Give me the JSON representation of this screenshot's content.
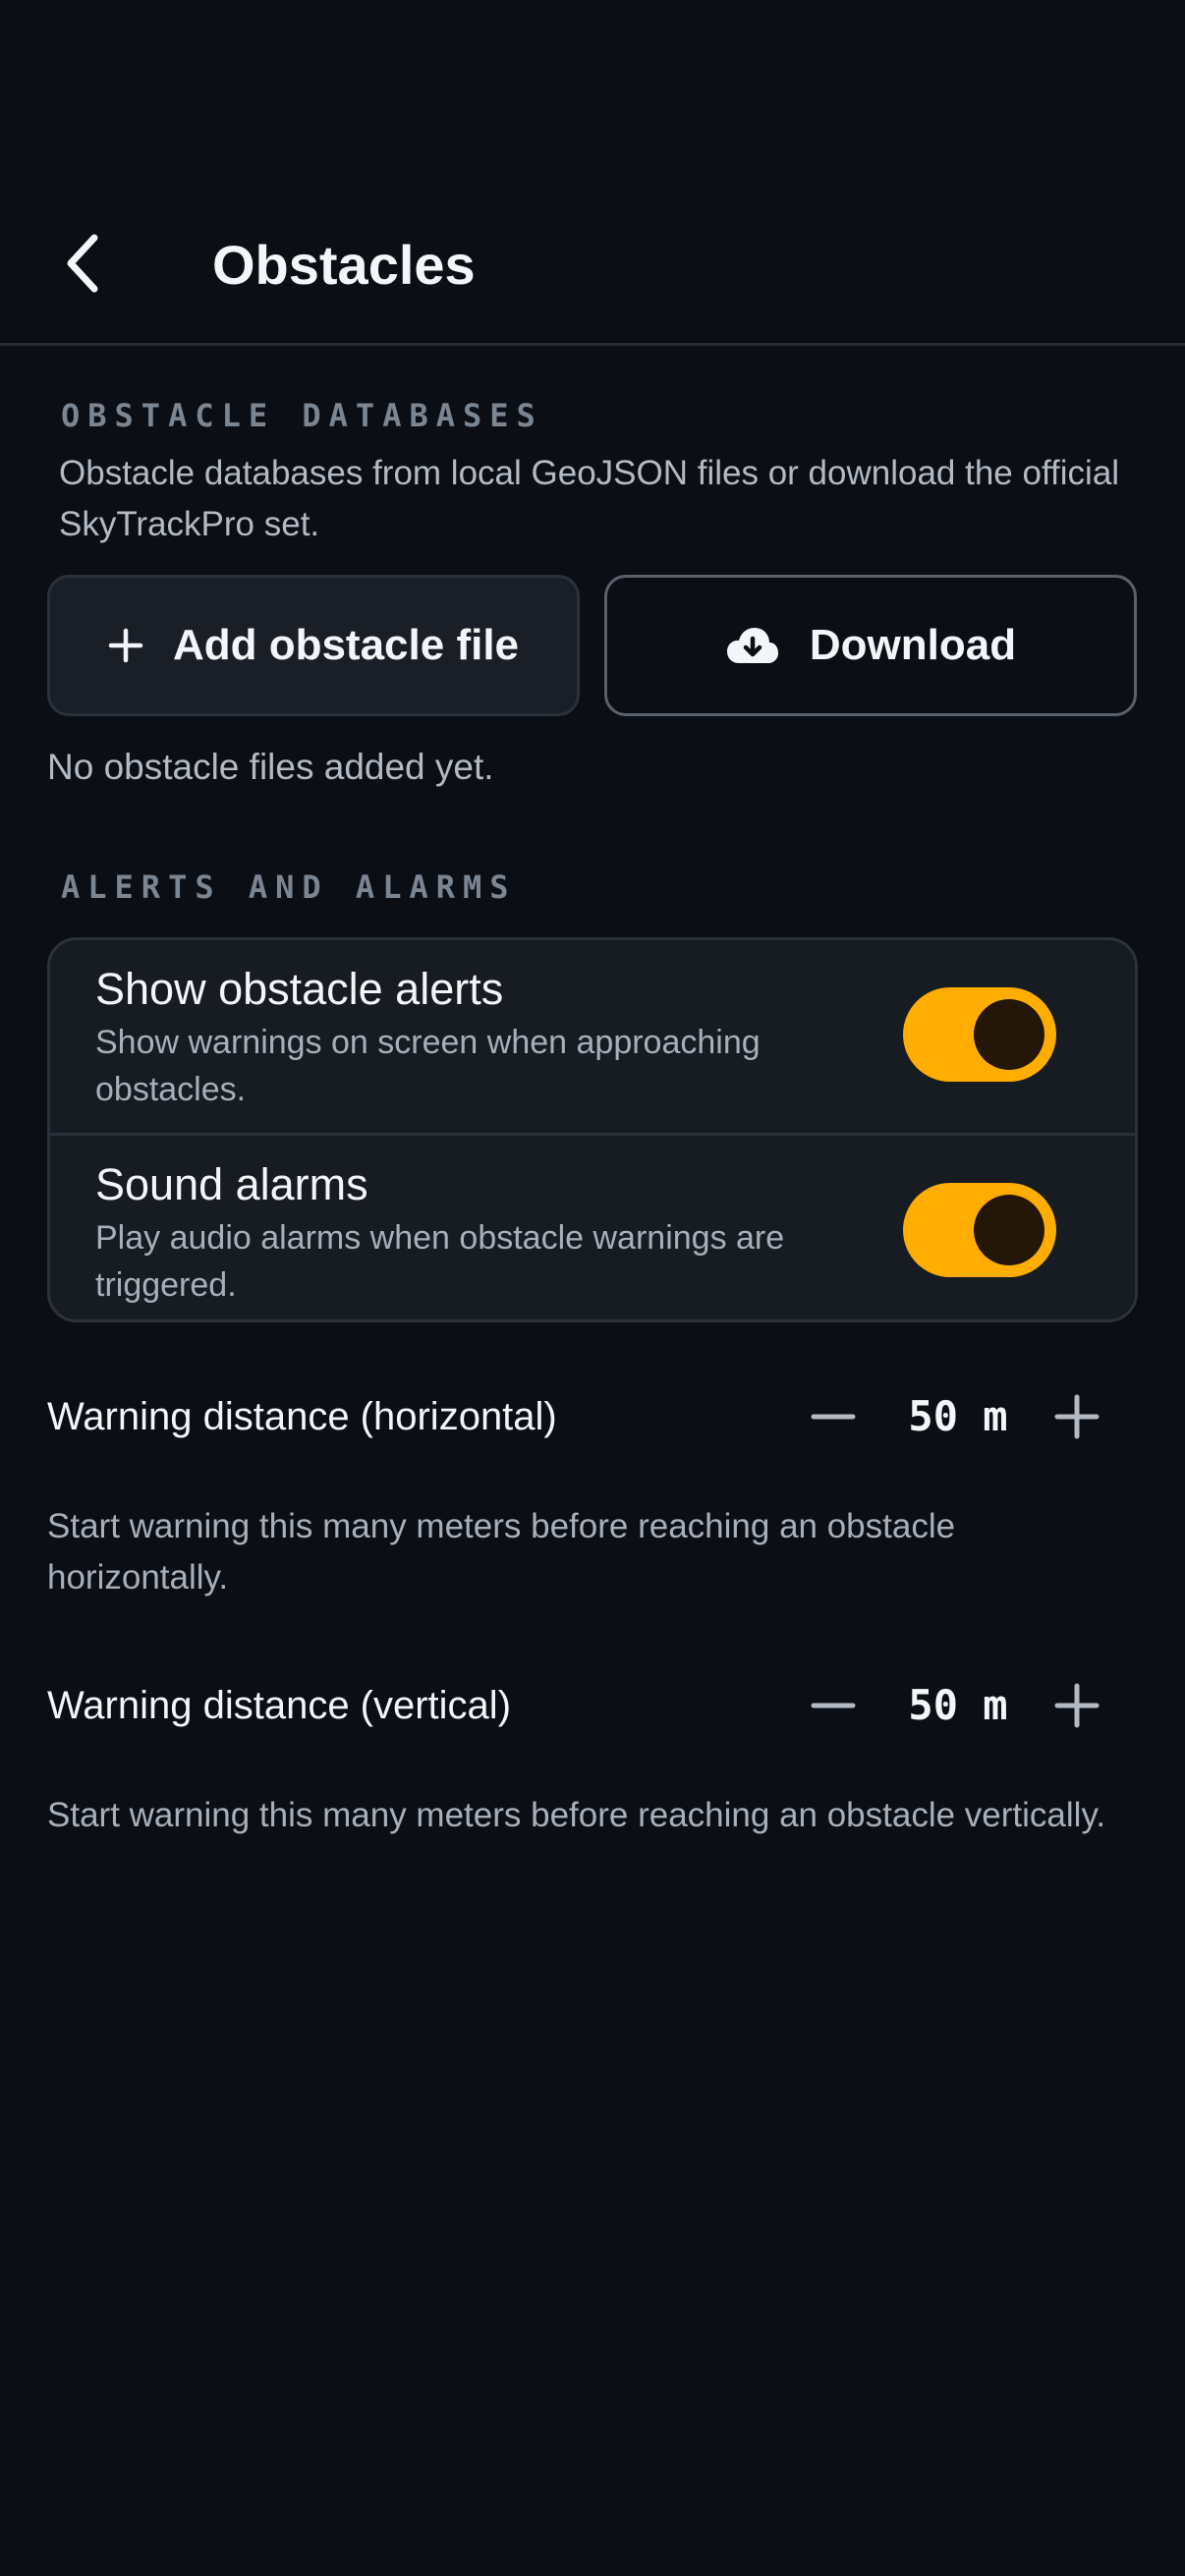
{
  "header": {
    "title": "Obstacles",
    "back_icon": "chevron-left-icon"
  },
  "obstacle_databases": {
    "section_label": "OBSTACLE DATABASES",
    "description": "Obstacle databases from local GeoJSON files or download the official SkyTrackPro set.",
    "add_button": {
      "label": "Add obstacle file",
      "icon": "plus-icon"
    },
    "download_button": {
      "label": "Download",
      "icon": "cloud-download-icon"
    },
    "empty_text": "No obstacle files added yet."
  },
  "alerts": {
    "section_label": "ALERTS AND ALARMS",
    "rows": [
      {
        "title": "Show obstacle alerts",
        "description": "Show warnings on screen when approaching obstacles.",
        "enabled": true
      },
      {
        "title": "Sound alarms",
        "description": "Play audio alarms when obstacle warnings are triggered.",
        "enabled": true
      }
    ]
  },
  "warning_horizontal": {
    "label": "Warning distance (horizontal)",
    "value": "50 m",
    "description": "Start warning this many meters before reaching an obstacle horizontally."
  },
  "warning_vertical": {
    "label": "Warning distance (vertical)",
    "value": "50 m",
    "description": "Start warning this many meters before reaching an obstacle vertically."
  },
  "colors": {
    "background": "#0b0e15",
    "accent": "#ffad00",
    "card": "#171c23",
    "muted_text": "#a7afba"
  }
}
